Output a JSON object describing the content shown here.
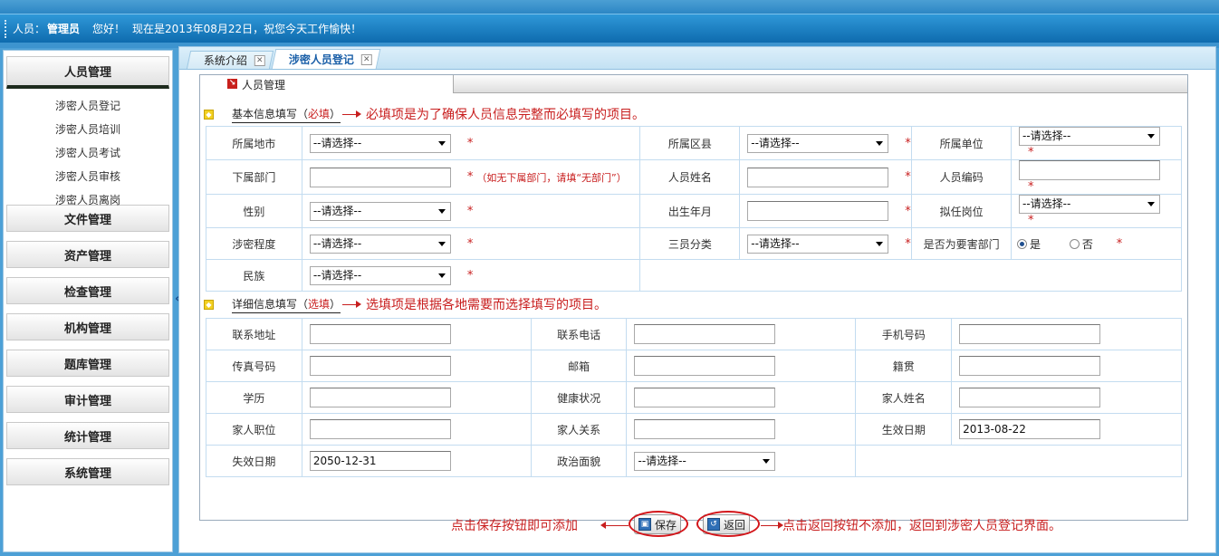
{
  "topbar": {
    "user_label": "人员：",
    "user_name": "管理员",
    "greeting": "您好！",
    "date_text": "现在是2013年08月22日，祝您今天工作愉快！"
  },
  "sidebar": {
    "active_menu": "人员管理",
    "sub_items": [
      "涉密人员登记",
      "涉密人员培训",
      "涉密人员考试",
      "涉密人员审核",
      "涉密人员离岗"
    ],
    "menus": [
      "文件管理",
      "资产管理",
      "检查管理",
      "机构管理",
      "题库管理",
      "审计管理",
      "统计管理",
      "系统管理"
    ],
    "collapse": "«"
  },
  "tabs": [
    {
      "label": "系统介绍"
    },
    {
      "label": "涉密人员登记"
    }
  ],
  "panel_title": "人员管理",
  "basic_section": {
    "label": "基本信息填写（",
    "required": "必填",
    "close": "）",
    "note": "必填项是为了确保人员信息完整而必填写的项目。"
  },
  "detail_section": {
    "label": "详细信息填写（",
    "optional": "选填",
    "close": "）",
    "note": "选填项是根据各地需要而选择填写的项目。"
  },
  "basic": {
    "star": "*",
    "select_default": "--请选择--",
    "region": "所属地市",
    "district": "所属区县",
    "unit": "所属单位",
    "dept": "下属部门",
    "dept_hint": "（如无下属部门，请填“无部门”）",
    "name": "人员姓名",
    "code": "人员编码",
    "gender": "性别",
    "birth": "出生年月",
    "post": "拟任岗位",
    "level": "涉密程度",
    "category": "三员分类",
    "key_dept": "是否为要害部门",
    "yes": "是",
    "no": "否",
    "ethnic": "民族"
  },
  "detail": {
    "address": "联系地址",
    "phone": "联系电话",
    "mobile": "手机号码",
    "fax": "传真号码",
    "email": "邮箱",
    "native": "籍贯",
    "education": "学历",
    "health": "健康状况",
    "family_name": "家人姓名",
    "family_job": "家人职位",
    "family_rel": "家人关系",
    "effective": "生效日期",
    "effective_value": "2013-08-22",
    "expire": "失效日期",
    "expire_value": "2050-12-31",
    "political": "政治面貌",
    "political_value": "--请选择--"
  },
  "buttons": {
    "save": "保存",
    "back": "返回",
    "save_note": "点击保存按钮即可添加",
    "back_note": "点击返回按钮不添加，返回到涉密人员登记界面。"
  }
}
